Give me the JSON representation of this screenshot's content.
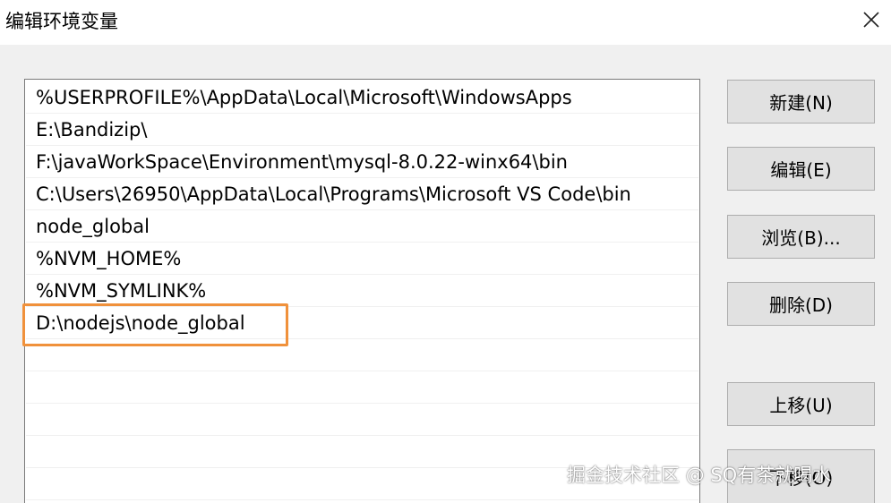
{
  "window": {
    "title": "编辑环境变量",
    "close_icon": "close-icon"
  },
  "path_list": {
    "entries": [
      "%USERPROFILE%\\AppData\\Local\\Microsoft\\WindowsApps",
      "E:\\Bandizip\\",
      "F:\\javaWorkSpace\\Environment\\mysql-8.0.22-winx64\\bin",
      "C:\\Users\\26950\\AppData\\Local\\Programs\\Microsoft VS Code\\bin",
      "node_global",
      "%NVM_HOME%",
      "%NVM_SYMLINK%",
      "D:\\nodejs\\node_global"
    ],
    "highlighted_entry_index": 7,
    "highlight_color": "#f0913b"
  },
  "buttons": {
    "new": "新建(N)",
    "edit": "编辑(E)",
    "browse": "浏览(B)...",
    "delete": "删除(D)",
    "move_up": "上移(U)",
    "move_down": "下移(O)"
  },
  "watermark": "掘金技术社区 @ SQ有茶就喝水"
}
